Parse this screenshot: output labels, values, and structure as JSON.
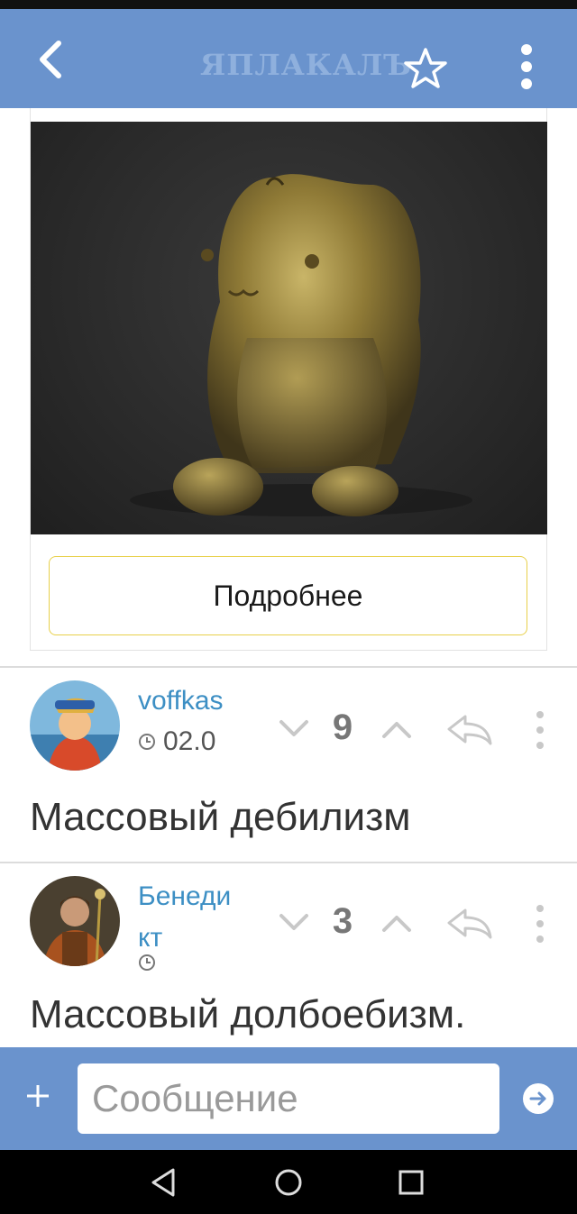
{
  "header": {
    "logo_text": "ЯПЛАКАЛЪ",
    "icons": [
      "chevron-left-icon",
      "star-icon",
      "more-vertical-icon"
    ]
  },
  "post": {
    "image_alt": "",
    "details_button": "Подробнее"
  },
  "comments": [
    {
      "username": "voffkas",
      "date": "02.0",
      "score": "9",
      "text": "Массовый дебилизм"
    },
    {
      "username": "Бенеди кт",
      "username_line1": "Бенеди",
      "username_line2": "кт",
      "score": "3",
      "text": "Массовый долбоебизм."
    }
  ],
  "composer": {
    "placeholder": "Сообщение"
  },
  "colors": {
    "bar": "#6a93cd",
    "username": "#3d8fc4",
    "button_border": "#e8d04a"
  }
}
